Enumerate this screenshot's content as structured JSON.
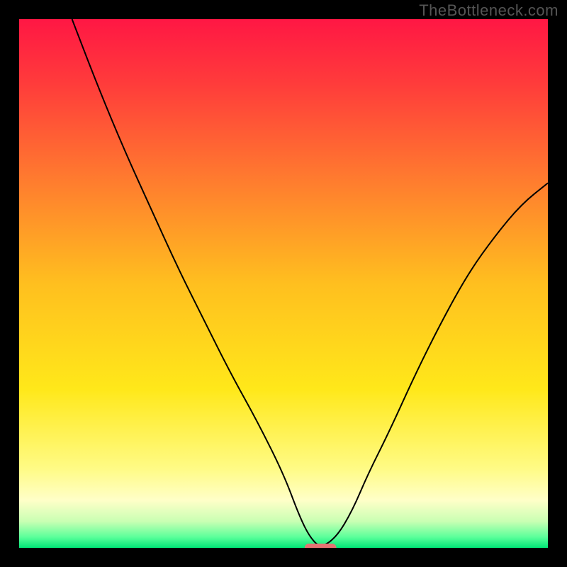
{
  "watermark": "TheBottleneck.com",
  "chart_data": {
    "type": "line",
    "title": "",
    "xlabel": "",
    "ylabel": "",
    "xlim": [
      0,
      100
    ],
    "ylim": [
      0,
      100
    ],
    "grid": false,
    "legend": false,
    "background_gradient": {
      "stops": [
        {
          "offset": 0.0,
          "color": "#ff1744"
        },
        {
          "offset": 0.12,
          "color": "#ff3b3b"
        },
        {
          "offset": 0.3,
          "color": "#ff7a2f"
        },
        {
          "offset": 0.5,
          "color": "#ffbf1f"
        },
        {
          "offset": 0.7,
          "color": "#ffe81a"
        },
        {
          "offset": 0.85,
          "color": "#fffb85"
        },
        {
          "offset": 0.91,
          "color": "#ffffc8"
        },
        {
          "offset": 0.95,
          "color": "#c9ffb3"
        },
        {
          "offset": 0.98,
          "color": "#59ff9a"
        },
        {
          "offset": 1.0,
          "color": "#00e676"
        }
      ]
    },
    "series": [
      {
        "name": "curve",
        "color": "#000000",
        "width": 2,
        "x": [
          10,
          15,
          20,
          25,
          30,
          35,
          40,
          45,
          50,
          53,
          55,
          57,
          60,
          63,
          66,
          70,
          75,
          80,
          85,
          90,
          95,
          100
        ],
        "y": [
          100,
          87,
          75,
          64,
          53,
          43,
          33,
          24,
          14,
          6,
          2,
          0,
          2,
          7,
          14,
          22,
          33,
          43,
          52,
          59,
          65,
          69
        ]
      }
    ],
    "marker": {
      "shape": "capsule",
      "color": "#e57373",
      "x_center": 57,
      "y": 0,
      "width": 6,
      "height": 1.6
    }
  }
}
